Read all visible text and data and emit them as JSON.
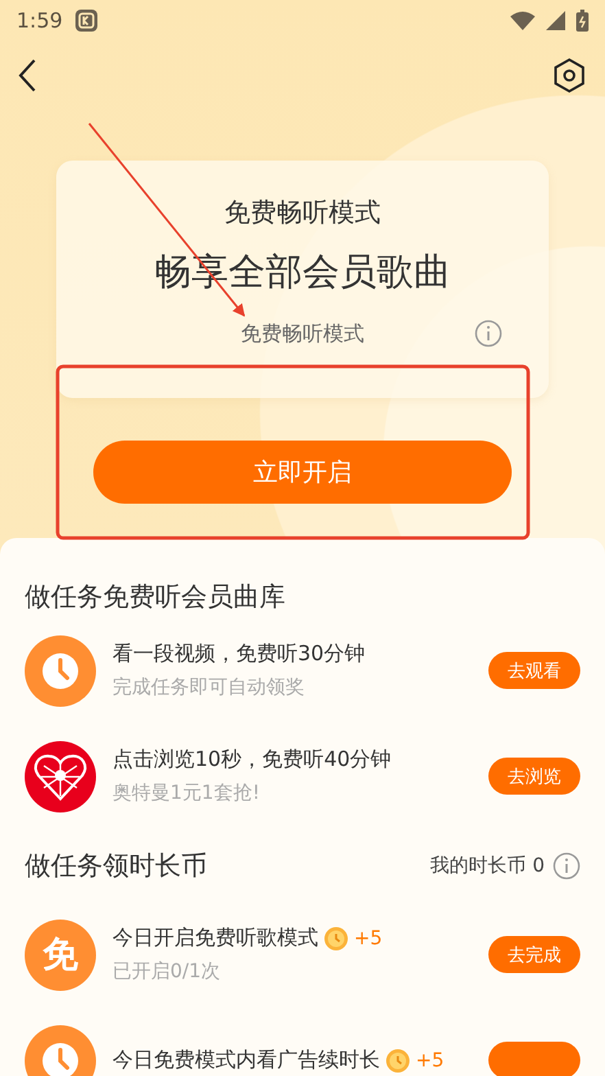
{
  "status_bar": {
    "time": "1:59"
  },
  "mode_card": {
    "label": "免费畅听模式",
    "headline": "畅享全部会员歌曲",
    "subtitle": "免费畅听模式"
  },
  "primary_button": "立即开启",
  "sections": [
    {
      "title": "做任务免费听会员曲库",
      "tasks": [
        {
          "kind": "clock",
          "title": "看一段视频，免费听30分钟",
          "subtitle": "完成任务即可自动领奖",
          "button": "去观看"
        },
        {
          "kind": "heart",
          "title": "点击浏览10秒，免费听40分钟",
          "subtitle": "奥特曼1元1套抢!",
          "button": "去浏览"
        }
      ]
    },
    {
      "title": "做任务领时长币",
      "balance": "我的时长币 0",
      "tasks": [
        {
          "kind": "free",
          "icon_text": "免",
          "title": "今日开启免费听歌模式",
          "reward": "+5",
          "subtitle": "已开启0/1次",
          "button": "去完成"
        },
        {
          "kind": "clock",
          "title": "今日免费模式内看广告续时长",
          "reward": "+5"
        }
      ]
    }
  ]
}
